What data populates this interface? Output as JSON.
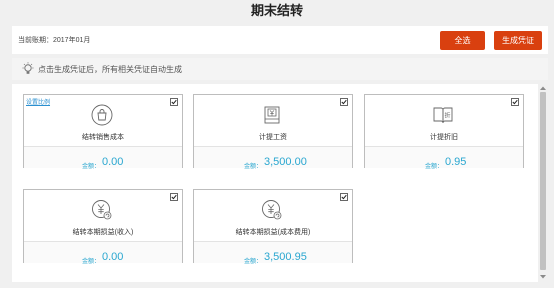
{
  "title": "期末结转",
  "period": {
    "label": "当前账期：",
    "value": "2017年01月"
  },
  "buttons": {
    "select_all": "全选",
    "generate": "生成凭证"
  },
  "hint": "点击生成凭证后，所有相关凭证自动生成",
  "amount_label": "金额：",
  "cards": [
    {
      "title": "结转销售成本",
      "amount": "0.00",
      "checked": true,
      "link": "设置比例",
      "icon": "bag-icon"
    },
    {
      "title": "计提工资",
      "amount": "3,500.00",
      "checked": true,
      "icon": "salary-icon"
    },
    {
      "title": "计提折旧",
      "amount": "0.95",
      "checked": true,
      "icon": "depreciation-icon"
    },
    {
      "title": "结转本期损益(收入)",
      "amount": "0.00",
      "checked": true,
      "icon": "yen-cycle-icon"
    },
    {
      "title": "结转本期损益(成本费用)",
      "amount": "3,500.95",
      "checked": true,
      "icon": "yen-cycle-icon"
    }
  ],
  "colors": {
    "accent": "#d9400f",
    "link": "#2aa7d0"
  }
}
